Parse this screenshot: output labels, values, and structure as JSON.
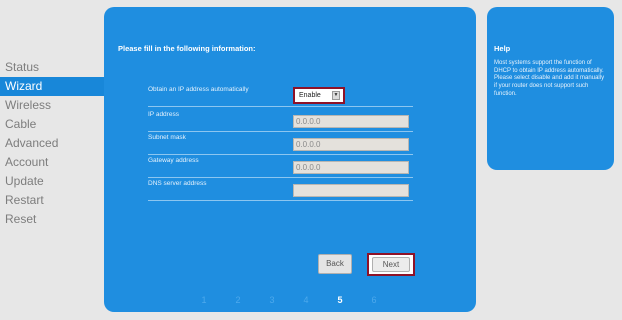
{
  "nav": {
    "items": [
      {
        "label": "Status",
        "active": false
      },
      {
        "label": "Wizard",
        "active": true
      },
      {
        "label": "Wireless",
        "active": false
      },
      {
        "label": "Cable",
        "active": false
      },
      {
        "label": "Advanced",
        "active": false
      },
      {
        "label": "Account",
        "active": false
      },
      {
        "label": "Update",
        "active": false
      },
      {
        "label": "Restart",
        "active": false
      },
      {
        "label": "Reset",
        "active": false
      }
    ]
  },
  "main": {
    "heading": "Please fill in the following information:",
    "dhcp": {
      "label": "Obtain an IP address automatically",
      "value": "Enable"
    },
    "fields": [
      {
        "label": "IP address",
        "value": "0.0.0.0"
      },
      {
        "label": "Subnet mask",
        "value": "0.0.0.0"
      },
      {
        "label": "Gateway address",
        "value": "0.0.0.0"
      },
      {
        "label": "DNS server address",
        "value": ""
      }
    ],
    "back_label": "Back",
    "next_label": "Next",
    "steps": [
      "1",
      "2",
      "3",
      "4",
      "5",
      "6"
    ],
    "current_step": "5"
  },
  "help": {
    "title": "Help",
    "text": "Most systems support the function of DHCP to obtain IP address automatically. Please select disable and add it manually if your router does not support such function."
  },
  "colors": {
    "panel_blue": "#1f8ee0",
    "nav_active": "#1887d9",
    "highlight_outline": "#8e1228"
  }
}
